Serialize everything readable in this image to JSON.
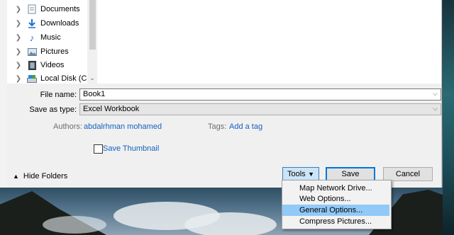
{
  "tree": {
    "items": [
      {
        "label": "Documents",
        "icon": "documents-icon"
      },
      {
        "label": "Downloads",
        "icon": "downloads-icon"
      },
      {
        "label": "Music",
        "icon": "music-icon"
      },
      {
        "label": "Pictures",
        "icon": "pictures-icon"
      },
      {
        "label": "Videos",
        "icon": "videos-icon"
      },
      {
        "label": "Local Disk (C:)",
        "icon": "local-disk-icon"
      }
    ]
  },
  "form": {
    "file_name_label": "File name:",
    "file_name_value": "Book1",
    "save_type_label": "Save as type:",
    "save_type_value": "Excel Workbook",
    "authors_label": "Authors:",
    "authors_value": "abdalrhman mohamed",
    "tags_label": "Tags:",
    "tags_value": "Add a tag",
    "thumbnail_label": "Save Thumbnail",
    "thumbnail_checked": false
  },
  "footer": {
    "hide_folders": "Hide Folders",
    "tools": "Tools",
    "save": "Save",
    "cancel": "Cancel"
  },
  "tools_menu": {
    "items": [
      {
        "label": "Map Network Drive..."
      },
      {
        "label": "Web Options..."
      },
      {
        "label": "General Options...",
        "highlighted": true
      },
      {
        "label": "Compress Pictures..."
      }
    ]
  },
  "colors": {
    "accent": "#0078d7",
    "link": "#1560c0",
    "menu_highlight": "#91c9f7"
  }
}
